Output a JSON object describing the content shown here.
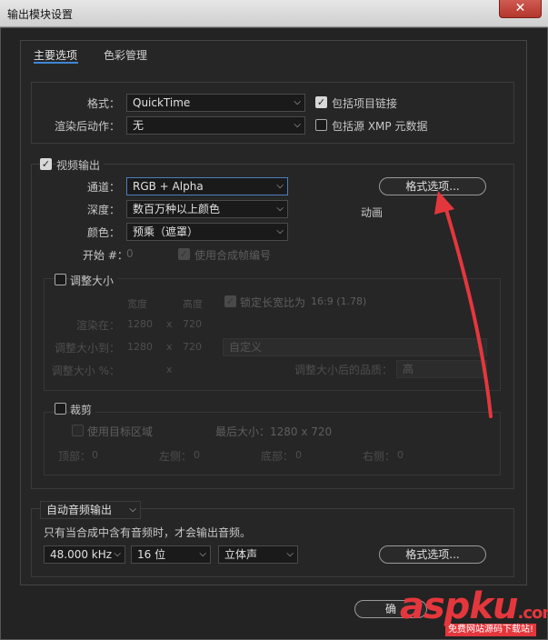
{
  "window": {
    "title": "输出模块设置",
    "close": "✕"
  },
  "tabs": [
    {
      "label": "主要选项"
    },
    {
      "label": "色彩管理"
    }
  ],
  "main": {
    "format_label": "格式：",
    "format_value": "QuickTime",
    "post_render_label": "渲染后动作：",
    "post_render_value": "无",
    "include_project_link": "包括项目链接",
    "include_xmp": "包括源 XMP 元数据"
  },
  "video": {
    "section_label": "视频输出",
    "channel_label": "通道：",
    "channel_value": "RGB + Alpha",
    "depth_label": "深度：",
    "depth_value": "数百万种以上颜色",
    "color_label": "颜色：",
    "color_value": "预乘（遮罩）",
    "start_label": "开始 #：",
    "start_value": "0",
    "use_comp_frame": "使用合成帧编号",
    "format_options_button": "格式选项...",
    "format_note": "动画"
  },
  "resize": {
    "section_label": "调整大小",
    "width_header": "宽度",
    "height_header": "高度",
    "lock_aspect": "锁定长宽比为",
    "aspect_value": "16:9 (1.78)",
    "render_at_label": "渲染在：",
    "render_w": "1280",
    "render_h": "720",
    "resize_to_label": "调整大小到：",
    "resize_w": "1280",
    "resize_h": "720",
    "custom_value": "自定义",
    "resize_pct_label": "调整大小 %：",
    "x_sign": "x",
    "quality_label": "调整大小后的品质：",
    "quality_value": "高"
  },
  "crop": {
    "section_label": "裁剪",
    "use_roi": "使用目标区域",
    "final_size": "最后大小：1280 x 720",
    "top_label": "顶部：",
    "top_value": "0",
    "left_label": "左侧：",
    "left_value": "0",
    "bottom_label": "底部：",
    "bottom_value": "0",
    "right_label": "右侧：",
    "right_value": "0"
  },
  "audio": {
    "mode_value": "自动音频输出",
    "note": "只有当合成中含有音频时，才会输出音频。",
    "rate_value": "48.000 kHz",
    "bits_value": "16 位",
    "channels_value": "立体声",
    "format_options_button": "格式选项..."
  },
  "footer": {
    "ok_button": "确"
  },
  "watermark": {
    "text": "aspku",
    "dot": ".com",
    "sub": "免费网站源码下载站!"
  },
  "colors": {
    "accent": "#3f86d6",
    "annotation_arrow": "#e4373d"
  }
}
